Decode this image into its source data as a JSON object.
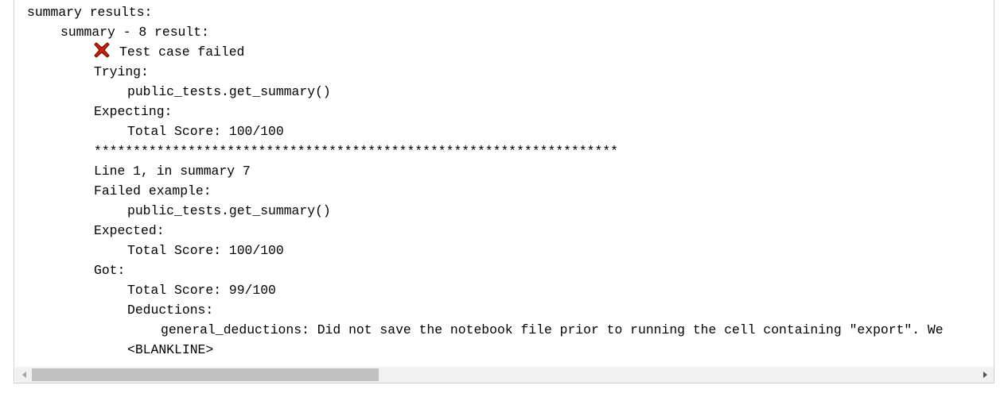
{
  "output": {
    "lines": [
      "summary results:",
      "summary - 8 result:",
      "Test case failed",
      "Trying:",
      "public_tests.get_summary()",
      "Expecting:",
      "Total Score: 100/100",
      "*******************************************************************",
      "Line 1, in summary 7",
      "Failed example:",
      "public_tests.get_summary()",
      "Expected:",
      "Total Score: 100/100",
      "Got:",
      "Total Score: 99/100",
      "Deductions:",
      "general_deductions: Did not save the notebook file prior to running the cell containing \"export\". We",
      "<BLANKLINE>"
    ]
  },
  "icons": {
    "fail_icon": "x-mark-icon",
    "fail_color": "#cc2200",
    "scroll_left": "triangle-left-icon",
    "scroll_right": "triangle-right-icon"
  },
  "scrollbar": {
    "thumb_fraction": 0.36
  }
}
